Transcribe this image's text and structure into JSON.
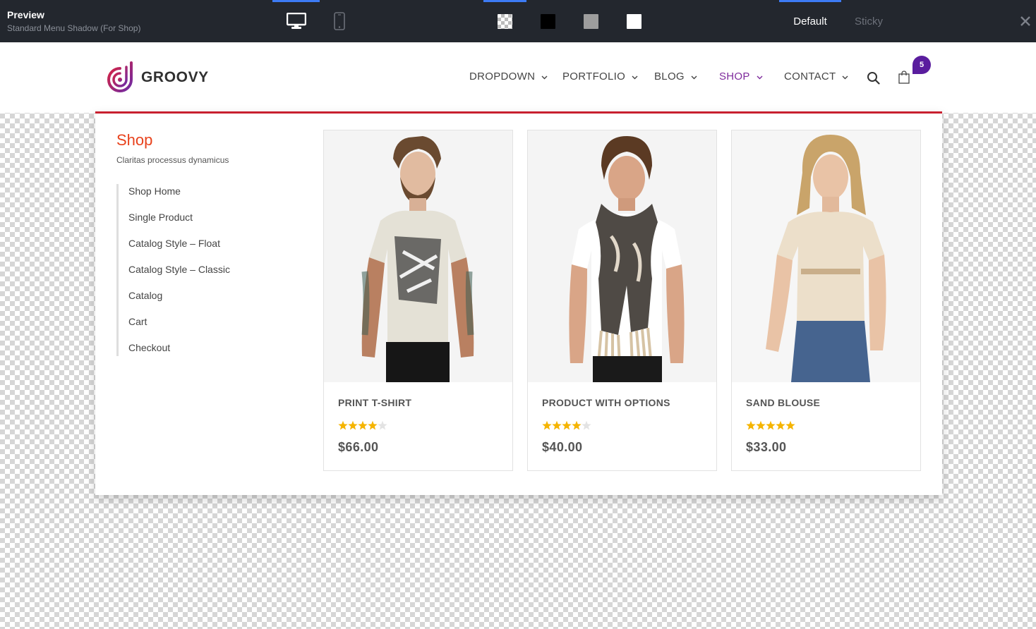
{
  "toolbar": {
    "title": "Preview",
    "subtitle": "Standard Menu Shadow (For Shop)",
    "devices": [
      {
        "name": "desktop",
        "icon": "desktop-icon",
        "active": true
      },
      {
        "name": "mobile",
        "icon": "mobile-icon",
        "active": false
      }
    ],
    "backgrounds": [
      {
        "name": "transparent",
        "active": true
      },
      {
        "name": "black",
        "color": "#000000",
        "active": false
      },
      {
        "name": "grey",
        "color": "#9d9d9d",
        "active": false
      },
      {
        "name": "white",
        "color": "#ffffff",
        "active": false
      }
    ],
    "modes": {
      "default_label": "Default",
      "sticky_label": "Sticky",
      "active": "Default"
    },
    "close_icon": "close-icon",
    "accent_color": "#3d7bf4"
  },
  "header": {
    "logo_text": "GROOVY",
    "nav": [
      {
        "label": "DROPDOWN",
        "active": false
      },
      {
        "label": "PORTFOLIO",
        "active": false
      },
      {
        "label": "BLOG",
        "active": false
      },
      {
        "label": "SHOP",
        "active": true
      },
      {
        "label": "CONTACT",
        "active": false
      }
    ],
    "active_color": "#7e2a9c",
    "search_icon": "search-icon",
    "cart_icon": "shopping-bag-icon",
    "cart_count": "5",
    "badge_color": "#5a1d9e"
  },
  "mega_menu": {
    "title": "Shop",
    "subtitle": "Claritas processus dynamicus",
    "accent_color": "#c8202f",
    "links": [
      "Shop Home",
      "Single Product",
      "Catalog Style – Float",
      "Catalog Style – Classic",
      "Catalog",
      "Cart",
      "Checkout"
    ],
    "products": [
      {
        "name": "PRINT T-SHIRT",
        "rating": 4,
        "max_rating": 5,
        "price": "$66.00"
      },
      {
        "name": "PRODUCT WITH OPTIONS",
        "rating": 4,
        "max_rating": 5,
        "price": "$40.00"
      },
      {
        "name": "SAND BLOUSE",
        "rating": 5,
        "max_rating": 5,
        "price": "$33.00"
      }
    ],
    "star_color": "#f5b400"
  }
}
